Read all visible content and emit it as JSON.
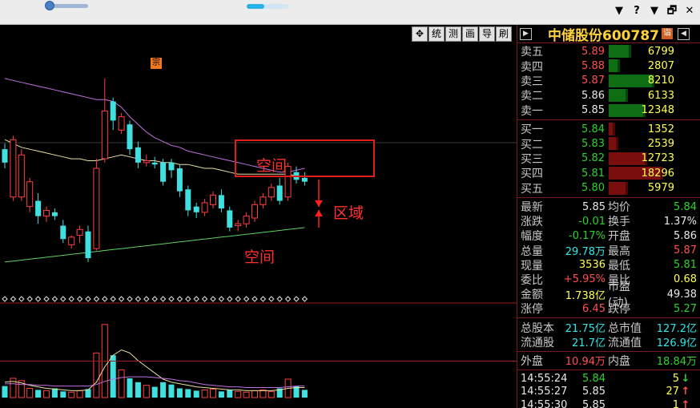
{
  "toolbar": {
    "buttons": [
      {
        "icon": "move-icon",
        "label": "✥"
      },
      {
        "label": "统"
      },
      {
        "label": "测"
      },
      {
        "label": "画"
      },
      {
        "label": "导"
      },
      {
        "label": "刷"
      }
    ],
    "window_buttons": [
      "▼",
      "?",
      "▼",
      "🗗",
      "✕"
    ]
  },
  "quote": {
    "title": "中储股份600787",
    "badge": "诣",
    "sell": [
      {
        "label": "卖五",
        "price": "5.89",
        "volume": "6799",
        "price_color": "red",
        "bar_fraction": 0.3
      },
      {
        "label": "卖四",
        "price": "5.88",
        "volume": "2807",
        "price_color": "red",
        "bar_fraction": 0.13
      },
      {
        "label": "卖三",
        "price": "5.87",
        "volume": "8210",
        "price_color": "red",
        "bar_fraction": 0.66
      },
      {
        "label": "卖二",
        "price": "5.86",
        "volume": "6133",
        "price_color": "white",
        "bar_fraction": 0.26
      },
      {
        "label": "卖一",
        "price": "5.85",
        "volume": "12348",
        "price_color": "white",
        "bar_fraction": 0.52
      }
    ],
    "buy": [
      {
        "label": "买一",
        "price": "5.84",
        "volume": "1352",
        "price_color": "green",
        "bar_fraction": 0.06
      },
      {
        "label": "买二",
        "price": "5.83",
        "volume": "2539",
        "price_color": "green",
        "bar_fraction": 0.11
      },
      {
        "label": "买三",
        "price": "5.82",
        "volume": "12723",
        "price_color": "green",
        "bar_fraction": 0.55
      },
      {
        "label": "买四",
        "price": "5.81",
        "volume": "18296",
        "price_color": "green",
        "bar_fraction": 0.79
      },
      {
        "label": "买五",
        "price": "5.80",
        "volume": "5979",
        "price_color": "green",
        "bar_fraction": 0.26
      }
    ],
    "stats": [
      {
        "l1": "最新",
        "v1": "5.85",
        "c1": "white",
        "l2": "均价",
        "v2": "5.84",
        "c2": "green"
      },
      {
        "l1": "涨跌",
        "v1": "-0.01",
        "c1": "green",
        "l2": "换手",
        "v2": "1.37%",
        "c2": "white"
      },
      {
        "l1": "幅度",
        "v1": "-0.17%",
        "c1": "green",
        "l2": "开盘",
        "v2": "5.86",
        "c2": "white"
      },
      {
        "l1": "总量",
        "v1": "29.78万",
        "c1": "cyan",
        "l2": "最高",
        "v2": "5.87",
        "c2": "red"
      },
      {
        "l1": "现量",
        "v1": "3536",
        "c1": "yellow",
        "l2": "最低",
        "v2": "5.81",
        "c2": "green"
      },
      {
        "l1": "委比",
        "v1": "+5.95%",
        "c1": "red",
        "l2": "量比",
        "v2": "0.68",
        "c2": "yellow"
      },
      {
        "l1": "金额",
        "v1": "1.738亿",
        "c1": "yellow",
        "l2": "市盈(动)",
        "v2": "49.38",
        "c2": "white"
      },
      {
        "l1": "涨停",
        "v1": "6.45",
        "c1": "red",
        "l2": "跌停",
        "v2": "5.27",
        "c2": "green"
      }
    ],
    "shares": [
      {
        "l1": "总股本",
        "v1": "21.75亿",
        "l2": "总市值",
        "v2": "127.2亿"
      },
      {
        "l1": "流通股",
        "v1": "21.7亿",
        "l2": "流通值",
        "v2": "126.9亿"
      }
    ],
    "outer_inner": {
      "outer_label": "外盘",
      "outer_value": "10.94万",
      "inner_label": "内盘",
      "inner_value": "18.84万"
    },
    "ticks": [
      {
        "time": "14:55:24",
        "price": "5.84",
        "price_color": "green",
        "volume": "5",
        "arrow": "↓",
        "arrow_color": "green"
      },
      {
        "time": "14:55:27",
        "price": "5.85",
        "price_color": "white",
        "volume": "27",
        "arrow": "↑",
        "arrow_color": "red"
      },
      {
        "time": "14:55:30",
        "price": "5.85",
        "price_color": "white",
        "volume": "1",
        "arrow": "↑",
        "arrow_color": "red"
      }
    ]
  },
  "annotations": {
    "space_top": "空间",
    "space_bottom": "空间",
    "region": "区域",
    "marker": "宗"
  },
  "chart_data": {
    "type": "candlestick",
    "candles": [
      {
        "o": 5.55,
        "c": 5.48,
        "h": 5.58,
        "l": 5.45
      },
      {
        "o": 5.3,
        "c": 5.6,
        "h": 5.62,
        "l": 5.28
      },
      {
        "o": 5.3,
        "c": 5.52,
        "h": 5.55,
        "l": 5.28
      },
      {
        "o": 5.25,
        "c": 5.38,
        "h": 5.4,
        "l": 5.22
      },
      {
        "o": 5.28,
        "c": 5.2,
        "h": 5.32,
        "l": 5.16
      },
      {
        "o": 5.2,
        "c": 5.23,
        "h": 5.25,
        "l": 5.17
      },
      {
        "o": 5.22,
        "c": 5.2,
        "h": 5.24,
        "l": 5.18
      },
      {
        "o": 5.15,
        "c": 5.08,
        "h": 5.18,
        "l": 5.06
      },
      {
        "o": 5.05,
        "c": 5.09,
        "h": 5.1,
        "l": 5.03
      },
      {
        "o": 5.1,
        "c": 5.13,
        "h": 5.15,
        "l": 5.06
      },
      {
        "o": 5.12,
        "c": 4.98,
        "h": 5.15,
        "l": 4.96
      },
      {
        "o": 5.03,
        "c": 5.45,
        "h": 5.5,
        "l": 5.02
      },
      {
        "o": 5.5,
        "c": 5.75,
        "h": 5.92,
        "l": 5.48
      },
      {
        "o": 5.8,
        "c": 5.7,
        "h": 5.82,
        "l": 5.65
      },
      {
        "o": 5.65,
        "c": 5.72,
        "h": 5.74,
        "l": 5.63
      },
      {
        "o": 5.68,
        "c": 5.55,
        "h": 5.7,
        "l": 5.52
      },
      {
        "o": 5.56,
        "c": 5.48,
        "h": 5.59,
        "l": 5.45
      },
      {
        "o": 5.48,
        "c": 5.49,
        "h": 5.52,
        "l": 5.46
      },
      {
        "o": 5.48,
        "c": 5.47,
        "h": 5.51,
        "l": 5.45
      },
      {
        "o": 5.48,
        "c": 5.38,
        "h": 5.5,
        "l": 5.36
      },
      {
        "o": 5.48,
        "c": 5.44,
        "h": 5.5,
        "l": 5.4
      },
      {
        "o": 5.45,
        "c": 5.33,
        "h": 5.47,
        "l": 5.3
      },
      {
        "o": 5.34,
        "c": 5.23,
        "h": 5.36,
        "l": 5.2
      },
      {
        "o": 5.25,
        "c": 5.22,
        "h": 5.27,
        "l": 5.19
      },
      {
        "o": 5.22,
        "c": 5.27,
        "h": 5.29,
        "l": 5.2
      },
      {
        "o": 5.26,
        "c": 5.31,
        "h": 5.33,
        "l": 5.24
      },
      {
        "o": 5.31,
        "c": 5.24,
        "h": 5.34,
        "l": 5.22
      },
      {
        "o": 5.23,
        "c": 5.14,
        "h": 5.25,
        "l": 5.12
      },
      {
        "o": 5.15,
        "c": 5.16,
        "h": 5.18,
        "l": 5.12
      },
      {
        "o": 5.16,
        "c": 5.2,
        "h": 5.22,
        "l": 5.14
      },
      {
        "o": 5.19,
        "c": 5.26,
        "h": 5.28,
        "l": 5.17
      },
      {
        "o": 5.26,
        "c": 5.3,
        "h": 5.32,
        "l": 5.24
      },
      {
        "o": 5.3,
        "c": 5.35,
        "h": 5.37,
        "l": 5.28
      },
      {
        "o": 5.36,
        "c": 5.28,
        "h": 5.4,
        "l": 5.26
      },
      {
        "o": 5.3,
        "c": 5.46,
        "h": 5.48,
        "l": 5.28
      },
      {
        "o": 5.43,
        "c": 5.39,
        "h": 5.46,
        "l": 5.37
      },
      {
        "o": 5.4,
        "c": 5.38,
        "h": 5.43,
        "l": 5.36
      }
    ],
    "ma_purple": [
      5.92,
      5.91,
      5.9,
      5.89,
      5.88,
      5.87,
      5.86,
      5.85,
      5.84,
      5.83,
      5.82,
      5.81,
      5.81,
      5.8,
      5.77,
      5.72,
      5.68,
      5.64,
      5.61,
      5.59,
      5.57,
      5.56,
      5.54,
      5.53,
      5.52,
      5.51,
      5.5,
      5.49,
      5.48,
      5.47,
      5.46,
      5.45,
      5.44,
      5.43,
      5.43,
      5.44,
      5.45
    ],
    "ma_yellow": [
      5.6,
      5.58,
      5.56,
      5.55,
      5.54,
      5.53,
      5.52,
      5.51,
      5.5,
      5.5,
      5.49,
      5.49,
      5.5,
      5.51,
      5.52,
      5.51,
      5.5,
      5.49,
      5.49,
      5.48,
      5.48,
      5.47,
      5.47,
      5.46,
      5.45,
      5.45,
      5.44,
      5.43,
      5.42,
      5.42,
      5.42,
      5.42,
      5.42,
      5.42,
      5.42,
      5.41,
      5.41
    ],
    "ma_green": [
      4.96,
      4.965,
      4.97,
      4.975,
      4.98,
      4.985,
      4.99,
      4.995,
      5.0,
      5.005,
      5.01,
      5.015,
      5.02,
      5.025,
      5.03,
      5.035,
      5.04,
      5.045,
      5.05,
      5.055,
      5.06,
      5.065,
      5.07,
      5.075,
      5.08,
      5.085,
      5.09,
      5.095,
      5.1,
      5.105,
      5.11,
      5.115,
      5.12,
      5.125,
      5.13,
      5.135,
      5.14
    ],
    "volumes": [
      0.15,
      0.25,
      0.22,
      0.12,
      0.1,
      0.09,
      0.12,
      0.08,
      0.07,
      0.09,
      0.11,
      0.58,
      0.95,
      0.55,
      0.36,
      0.25,
      0.2,
      0.16,
      0.14,
      0.2,
      0.17,
      0.12,
      0.11,
      0.09,
      0.1,
      0.11,
      0.08,
      0.1,
      0.08,
      0.07,
      0.09,
      0.1,
      0.08,
      0.12,
      0.24,
      0.15,
      0.1
    ],
    "vol_ma_yellow": [
      0.2,
      0.21,
      0.19,
      0.16,
      0.14,
      0.12,
      0.11,
      0.1,
      0.09,
      0.09,
      0.1,
      0.2,
      0.4,
      0.55,
      0.62,
      0.58,
      0.48,
      0.4,
      0.32,
      0.24,
      0.2,
      0.18,
      0.16,
      0.14,
      0.13,
      0.12,
      0.11,
      0.1,
      0.1,
      0.09,
      0.09,
      0.09,
      0.09,
      0.1,
      0.12,
      0.13,
      0.13
    ],
    "vol_ma_purple": [
      0.18,
      0.18,
      0.17,
      0.17,
      0.16,
      0.16,
      0.15,
      0.15,
      0.15,
      0.15,
      0.15,
      0.17,
      0.21,
      0.24,
      0.26,
      0.27,
      0.27,
      0.27,
      0.26,
      0.25,
      0.24,
      0.22,
      0.21,
      0.19,
      0.17,
      0.16,
      0.15,
      0.14,
      0.14,
      0.13,
      0.13,
      0.13,
      0.13,
      0.13,
      0.14,
      0.15,
      0.15
    ],
    "ylim": [
      4.8,
      6.1
    ]
  }
}
